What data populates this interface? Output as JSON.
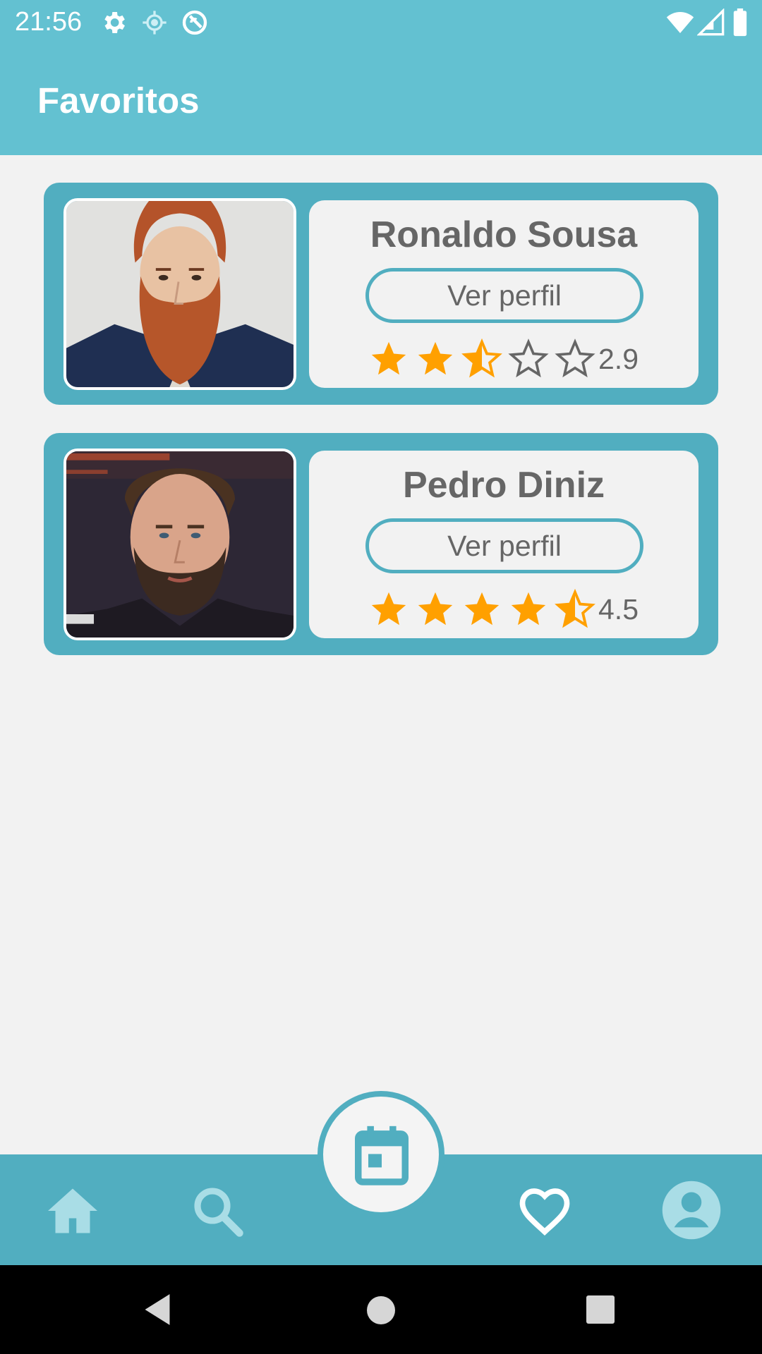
{
  "status_bar": {
    "time": "21:56",
    "left_icons": [
      "gear-icon",
      "location-icon",
      "sync-off-icon"
    ],
    "right_icons": [
      "wifi-icon",
      "cell-signal-icon",
      "battery-icon"
    ]
  },
  "app_bar": {
    "title": "Favoritos"
  },
  "favorites": [
    {
      "name": "Ronaldo Sousa",
      "button_label": "Ver perfil",
      "rating": 2.9,
      "rating_label": "2.9",
      "photo": "red-bearded-man-photo"
    },
    {
      "name": "Pedro Diniz",
      "button_label": "Ver perfil",
      "rating": 4.5,
      "rating_label": "4.5",
      "photo": "bearded-man-photo"
    }
  ],
  "bottom_nav": {
    "items": [
      "home-icon",
      "search-icon",
      "calendar-icon",
      "favorites-heart-icon",
      "profile-icon"
    ],
    "active": "favorites"
  },
  "system_nav": [
    "back-icon",
    "home-circle-icon",
    "recents-icon"
  ],
  "colors": {
    "primary": "#63c1d1",
    "card": "#51aec0",
    "star": "#ffa000",
    "text": "#666666"
  }
}
